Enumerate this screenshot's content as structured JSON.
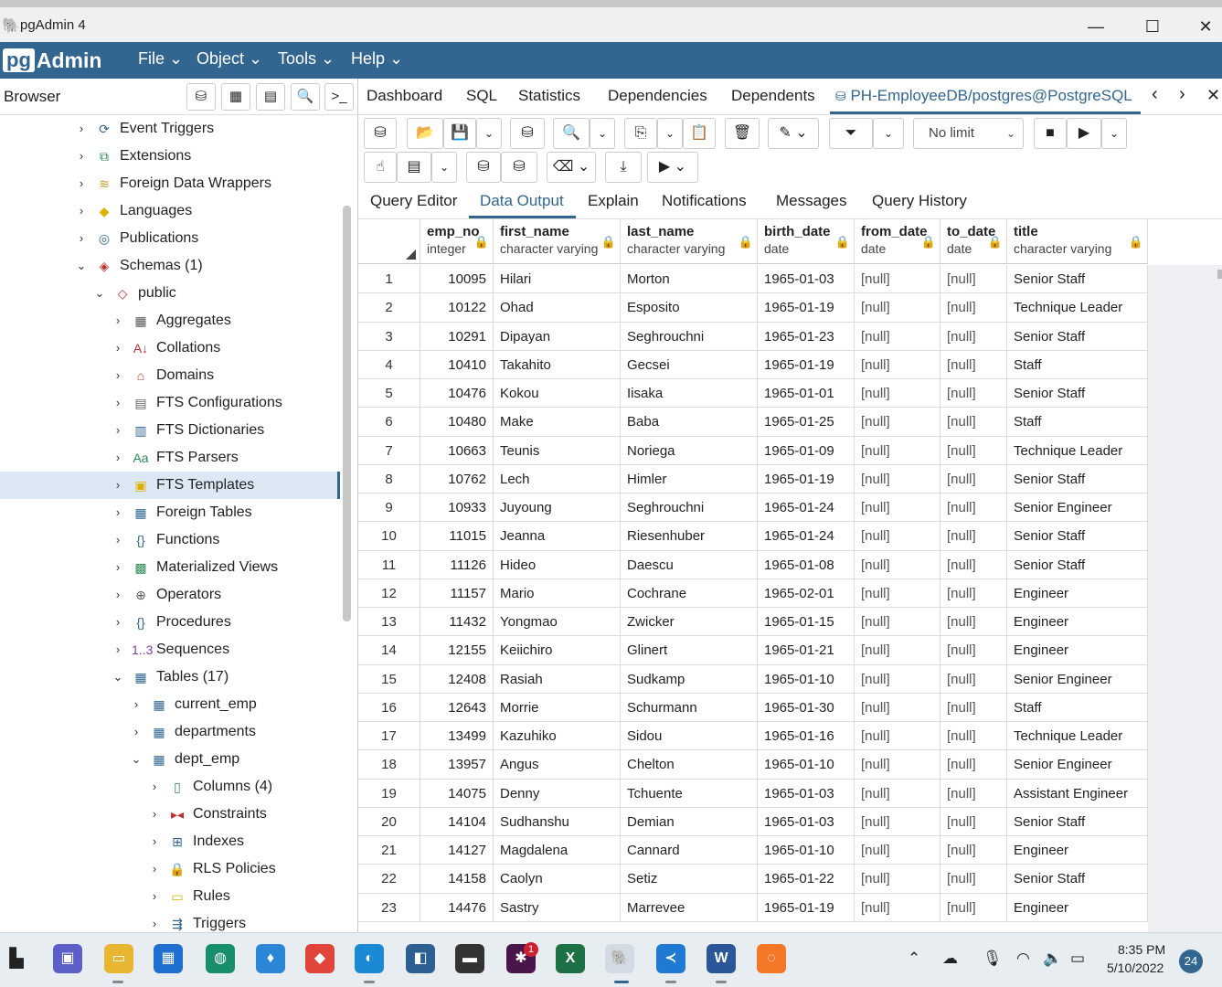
{
  "window": {
    "title": "pgAdmin 4",
    "minimize": "—",
    "maximize": "☐",
    "close": "✕"
  },
  "menubar": {
    "logo_pg": "pg",
    "logo_admin": "Admin",
    "items": [
      "File",
      "Object",
      "Tools",
      "Help"
    ]
  },
  "browser": {
    "label": "Browser",
    "tree": [
      {
        "label": "Event Triggers",
        "icon": "event-trigger-icon",
        "glyph": "⟳",
        "color": "#326690"
      },
      {
        "label": "Extensions",
        "icon": "extension-icon",
        "glyph": "⧉",
        "color": "#2e8b57"
      },
      {
        "label": "Foreign Data Wrappers",
        "icon": "fdw-icon",
        "glyph": "≋",
        "color": "#c89b2d"
      },
      {
        "label": "Languages",
        "icon": "language-icon",
        "glyph": "◆",
        "color": "#e0b000"
      },
      {
        "label": "Publications",
        "icon": "publication-icon",
        "glyph": "◎",
        "color": "#326690"
      },
      {
        "label": "Schemas (1)",
        "icon": "schemas-icon",
        "glyph": "◈",
        "color": "#c03030"
      },
      {
        "label": "public",
        "icon": "schema-icon",
        "glyph": "◇",
        "color": "#c03030"
      },
      {
        "label": "Aggregates",
        "icon": "aggregate-icon",
        "glyph": "▦",
        "color": "#555555"
      },
      {
        "label": "Collations",
        "icon": "collation-icon",
        "glyph": "A↓",
        "color": "#c03030"
      },
      {
        "label": "Domains",
        "icon": "domain-icon",
        "glyph": "⌂",
        "color": "#b03a2e"
      },
      {
        "label": "FTS Configurations",
        "icon": "fts-config-icon",
        "glyph": "▤",
        "color": "#666666"
      },
      {
        "label": "FTS Dictionaries",
        "icon": "fts-dictionary-icon",
        "glyph": "▥",
        "color": "#326690"
      },
      {
        "label": "FTS Parsers",
        "icon": "fts-parser-icon",
        "glyph": "Aa",
        "color": "#2e8b57"
      },
      {
        "label": "FTS Templates",
        "icon": "fts-template-icon",
        "glyph": "▣",
        "color": "#e0b000"
      },
      {
        "label": "Foreign Tables",
        "icon": "foreign-table-icon",
        "glyph": "▦",
        "color": "#326690"
      },
      {
        "label": "Functions",
        "icon": "function-icon",
        "glyph": "{}",
        "color": "#326690"
      },
      {
        "label": "Materialized Views",
        "icon": "materialized-view-icon",
        "glyph": "▩",
        "color": "#2e8b57"
      },
      {
        "label": "Operators",
        "icon": "operator-icon",
        "glyph": "⊕",
        "color": "#555555"
      },
      {
        "label": "Procedures",
        "icon": "procedure-icon",
        "glyph": "{}",
        "color": "#326690"
      },
      {
        "label": "Sequences",
        "icon": "sequence-icon",
        "glyph": "1..3",
        "color": "#7a3fb0"
      },
      {
        "label": "Tables (17)",
        "icon": "tables-icon",
        "glyph": "▦",
        "color": "#326690"
      },
      {
        "label": "current_emp",
        "icon": "table-icon",
        "glyph": "▦",
        "color": "#326690"
      },
      {
        "label": "departments",
        "icon": "table-icon",
        "glyph": "▦",
        "color": "#326690"
      },
      {
        "label": "dept_emp",
        "icon": "table-icon",
        "glyph": "▦",
        "color": "#326690"
      },
      {
        "label": "Columns (4)",
        "icon": "columns-icon",
        "glyph": "▯",
        "color": "#2e8b57"
      },
      {
        "label": "Constraints",
        "icon": "constraint-icon",
        "glyph": "▸◂",
        "color": "#c03030"
      },
      {
        "label": "Indexes",
        "icon": "index-icon",
        "glyph": "⊞",
        "color": "#326690"
      },
      {
        "label": "RLS Policies",
        "icon": "rls-policy-icon",
        "glyph": "🔒",
        "color": "#2e8b57"
      },
      {
        "label": "Rules",
        "icon": "rule-icon",
        "glyph": "▭",
        "color": "#e0b000"
      },
      {
        "label": "Triggers",
        "icon": "trigger-icon",
        "glyph": "⇶",
        "color": "#326690"
      }
    ]
  },
  "main_tabs": [
    "Dashboard",
    "SQL",
    "Statistics",
    "Dependencies",
    "Dependents",
    "PH-EmployeeDB/postgres@PostgreSQL"
  ],
  "toolbar": {
    "limit": "No limit"
  },
  "sub_tabs": [
    "Query Editor",
    "Data Output",
    "Explain",
    "Notifications",
    "Messages",
    "Query History"
  ],
  "grid": {
    "columns": [
      {
        "name": "emp_no",
        "type": "integer"
      },
      {
        "name": "first_name",
        "type": "character varying"
      },
      {
        "name": "last_name",
        "type": "character varying"
      },
      {
        "name": "birth_date",
        "type": "date"
      },
      {
        "name": "from_date",
        "type": "date"
      },
      {
        "name": "to_date",
        "type": "date"
      },
      {
        "name": "title",
        "type": "character varying"
      }
    ],
    "rows": [
      [
        "1",
        "10095",
        "Hilari",
        "Morton",
        "1965-01-03",
        "[null]",
        "[null]",
        "Senior Staff"
      ],
      [
        "2",
        "10122",
        "Ohad",
        "Esposito",
        "1965-01-19",
        "[null]",
        "[null]",
        "Technique Leader"
      ],
      [
        "3",
        "10291",
        "Dipayan",
        "Seghrouchni",
        "1965-01-23",
        "[null]",
        "[null]",
        "Senior Staff"
      ],
      [
        "4",
        "10410",
        "Takahito",
        "Gecsei",
        "1965-01-19",
        "[null]",
        "[null]",
        "Staff"
      ],
      [
        "5",
        "10476",
        "Kokou",
        "Iisaka",
        "1965-01-01",
        "[null]",
        "[null]",
        "Senior Staff"
      ],
      [
        "6",
        "10480",
        "Make",
        "Baba",
        "1965-01-25",
        "[null]",
        "[null]",
        "Staff"
      ],
      [
        "7",
        "10663",
        "Teunis",
        "Noriega",
        "1965-01-09",
        "[null]",
        "[null]",
        "Technique Leader"
      ],
      [
        "8",
        "10762",
        "Lech",
        "Himler",
        "1965-01-19",
        "[null]",
        "[null]",
        "Senior Staff"
      ],
      [
        "9",
        "10933",
        "Juyoung",
        "Seghrouchni",
        "1965-01-24",
        "[null]",
        "[null]",
        "Senior Engineer"
      ],
      [
        "10",
        "11015",
        "Jeanna",
        "Riesenhuber",
        "1965-01-24",
        "[null]",
        "[null]",
        "Senior Staff"
      ],
      [
        "11",
        "11126",
        "Hideo",
        "Daescu",
        "1965-01-08",
        "[null]",
        "[null]",
        "Senior Staff"
      ],
      [
        "12",
        "11157",
        "Mario",
        "Cochrane",
        "1965-02-01",
        "[null]",
        "[null]",
        "Engineer"
      ],
      [
        "13",
        "11432",
        "Yongmao",
        "Zwicker",
        "1965-01-15",
        "[null]",
        "[null]",
        "Engineer"
      ],
      [
        "14",
        "12155",
        "Keiichiro",
        "Glinert",
        "1965-01-21",
        "[null]",
        "[null]",
        "Engineer"
      ],
      [
        "15",
        "12408",
        "Rasiah",
        "Sudkamp",
        "1965-01-10",
        "[null]",
        "[null]",
        "Senior Engineer"
      ],
      [
        "16",
        "12643",
        "Morrie",
        "Schurmann",
        "1965-01-30",
        "[null]",
        "[null]",
        "Staff"
      ],
      [
        "17",
        "13499",
        "Kazuhiko",
        "Sidou",
        "1965-01-16",
        "[null]",
        "[null]",
        "Technique Leader"
      ],
      [
        "18",
        "13957",
        "Angus",
        "Chelton",
        "1965-01-10",
        "[null]",
        "[null]",
        "Senior Engineer"
      ],
      [
        "19",
        "14075",
        "Denny",
        "Tchuente",
        "1965-01-03",
        "[null]",
        "[null]",
        "Assistant Engineer"
      ],
      [
        "20",
        "14104",
        "Sudhanshu",
        "Demian",
        "1965-01-03",
        "[null]",
        "[null]",
        "Senior Staff"
      ],
      [
        "21",
        "14127",
        "Magdalena",
        "Cannard",
        "1965-01-10",
        "[null]",
        "[null]",
        "Engineer"
      ],
      [
        "22",
        "14158",
        "Caolyn",
        "Setiz",
        "1965-01-22",
        "[null]",
        "[null]",
        "Senior Staff"
      ],
      [
        "23",
        "14476",
        "Sastry",
        "Marrevee",
        "1965-01-19",
        "[null]",
        "[null]",
        "Engineer"
      ]
    ]
  },
  "taskbar": {
    "time": "8:35 PM",
    "date": "5/10/2022",
    "notifications": "24",
    "slack_badge": "1"
  }
}
